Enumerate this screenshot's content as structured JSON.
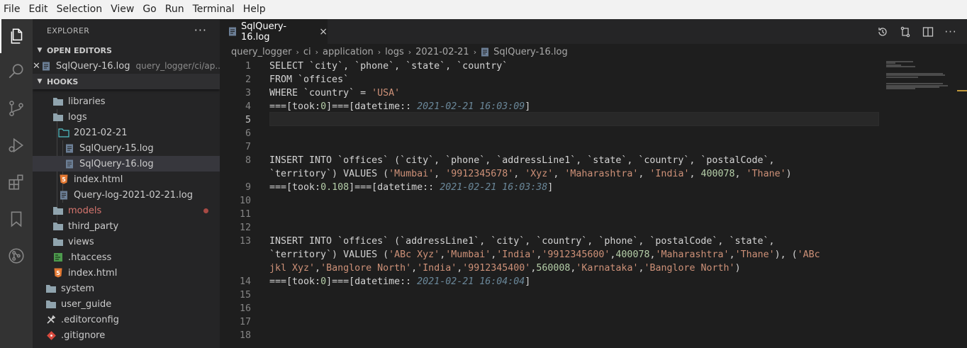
{
  "menu": [
    "File",
    "Edit",
    "Selection",
    "View",
    "Go",
    "Run",
    "Terminal",
    "Help"
  ],
  "sidebar": {
    "title": "EXPLORER",
    "open_editors_label": "OPEN EDITORS",
    "open_editor": {
      "name": "SqlQuery-16.log",
      "desc": "query_logger/ci/ap..."
    },
    "hooks_label": "HOOKS",
    "tree": [
      {
        "label": "libraries",
        "type": "folder"
      },
      {
        "label": "logs",
        "type": "folder"
      },
      {
        "label": "2021-02-21",
        "type": "folder-open"
      },
      {
        "label": "SqlQuery-15.log",
        "type": "log"
      },
      {
        "label": "SqlQuery-16.log",
        "type": "log"
      },
      {
        "label": "index.html",
        "type": "html"
      },
      {
        "label": "Query-log-2021-02-21.log",
        "type": "log"
      },
      {
        "label": "models",
        "type": "folder"
      },
      {
        "label": "third_party",
        "type": "folder"
      },
      {
        "label": "views",
        "type": "folder"
      },
      {
        "label": ".htaccess",
        "type": "htaccess"
      },
      {
        "label": "index.html",
        "type": "html"
      },
      {
        "label": "system",
        "type": "folder"
      },
      {
        "label": "user_guide",
        "type": "folder"
      },
      {
        "label": ".editorconfig",
        "type": "config"
      },
      {
        "label": ".gitignore",
        "type": "git"
      }
    ]
  },
  "tab": {
    "label": "SqlQuery-16.log",
    "close": "×"
  },
  "breadcrumb": [
    "query_logger",
    "ci",
    "application",
    "logs",
    "2021-02-21",
    "SqlQuery-16.log"
  ],
  "editor": {
    "line_numbers": [
      "1",
      "2",
      "3",
      "4",
      "5",
      "6",
      "7",
      "8",
      "9",
      "10",
      "11",
      "12",
      "13",
      "14",
      "15",
      "16",
      "17",
      "18"
    ],
    "lines": [
      {
        "ln": "1",
        "parts": [
          [
            "t",
            "SELECT `city`, `phone`, `state`, `country`"
          ]
        ]
      },
      {
        "ln": "2",
        "parts": [
          [
            "t",
            "FROM `offices`"
          ]
        ]
      },
      {
        "ln": "3",
        "parts": [
          [
            "t",
            "WHERE `country` = "
          ],
          [
            "s",
            "'USA'"
          ]
        ]
      },
      {
        "ln": "4",
        "parts": [
          [
            "t",
            "===[took:"
          ],
          [
            "n",
            "0"
          ],
          [
            "t",
            "]===[datetime:: "
          ],
          [
            "d",
            "2021-02-21 16:03:09"
          ],
          [
            "t",
            "]"
          ]
        ]
      },
      {
        "ln": "5",
        "parts": []
      },
      {
        "ln": "6",
        "parts": []
      },
      {
        "ln": "7",
        "parts": []
      },
      {
        "ln": "8",
        "parts": [
          [
            "t",
            "INSERT INTO `offices` (`city`, `phone`, `addressLine1`, `state`, `country`, `postalCode`,"
          ]
        ]
      },
      {
        "ln": "",
        "parts": [
          [
            "t",
            "`territory`) VALUES ("
          ],
          [
            "s",
            "'Mumbai'"
          ],
          [
            "t",
            ", "
          ],
          [
            "s",
            "'9912345678'"
          ],
          [
            "t",
            ", "
          ],
          [
            "s",
            "'Xyz'"
          ],
          [
            "t",
            ", "
          ],
          [
            "s",
            "'Maharashtra'"
          ],
          [
            "t",
            ", "
          ],
          [
            "s",
            "'India'"
          ],
          [
            "t",
            ", "
          ],
          [
            "n",
            "400078"
          ],
          [
            "t",
            ", "
          ],
          [
            "s",
            "'Thane'"
          ],
          [
            "t",
            ")"
          ]
        ]
      },
      {
        "ln": "9",
        "parts": [
          [
            "t",
            "===[took:"
          ],
          [
            "n",
            "0.108"
          ],
          [
            "t",
            "]===[datetime:: "
          ],
          [
            "d",
            "2021-02-21 16:03:38"
          ],
          [
            "t",
            "]"
          ]
        ]
      },
      {
        "ln": "10",
        "parts": []
      },
      {
        "ln": "11",
        "parts": []
      },
      {
        "ln": "12",
        "parts": []
      },
      {
        "ln": "13",
        "parts": [
          [
            "t",
            "INSERT INTO `offices` (`addressLine1`, `city`, `country`, `phone`, `postalCode`, `state`,"
          ]
        ]
      },
      {
        "ln": "",
        "parts": [
          [
            "t",
            "`territory`) VALUES ("
          ],
          [
            "s",
            "'ABc Xyz'"
          ],
          [
            "t",
            ","
          ],
          [
            "s",
            "'Mumbai'"
          ],
          [
            "t",
            ","
          ],
          [
            "s",
            "'India'"
          ],
          [
            "t",
            ","
          ],
          [
            "s",
            "'9912345600'"
          ],
          [
            "t",
            ","
          ],
          [
            "n",
            "400078"
          ],
          [
            "t",
            ","
          ],
          [
            "s",
            "'Maharashtra'"
          ],
          [
            "t",
            ","
          ],
          [
            "s",
            "'Thane'"
          ],
          [
            "t",
            "), ("
          ],
          [
            "s",
            "'ABc"
          ]
        ]
      },
      {
        "ln": "",
        "parts": [
          [
            "s",
            "jkl Xyz'"
          ],
          [
            "t",
            ","
          ],
          [
            "s",
            "'Banglore North'"
          ],
          [
            "t",
            ","
          ],
          [
            "s",
            "'India'"
          ],
          [
            "t",
            ","
          ],
          [
            "s",
            "'9912345400'"
          ],
          [
            "t",
            ","
          ],
          [
            "n",
            "560008"
          ],
          [
            "t",
            ","
          ],
          [
            "s",
            "'Karnataka'"
          ],
          [
            "t",
            ","
          ],
          [
            "s",
            "'Banglore North'"
          ],
          [
            "t",
            ")"
          ]
        ]
      },
      {
        "ln": "14",
        "parts": [
          [
            "t",
            "===[took:"
          ],
          [
            "n",
            "0"
          ],
          [
            "t",
            "]===[datetime:: "
          ],
          [
            "d",
            "2021-02-21 16:04:04"
          ],
          [
            "t",
            "]"
          ]
        ]
      },
      {
        "ln": "15",
        "parts": []
      },
      {
        "ln": "16",
        "parts": []
      },
      {
        "ln": "17",
        "parts": []
      },
      {
        "ln": "18",
        "parts": []
      }
    ]
  },
  "icons": {
    "activity": [
      "files-icon",
      "search-icon",
      "source-control-icon",
      "run-debug-icon",
      "extensions-icon",
      "bookmarks-icon",
      "git-graph-icon"
    ],
    "tab_actions": [
      "timeline-icon",
      "compare-changes-icon",
      "split-editor-icon",
      "more-actions-icon"
    ]
  },
  "colors": {
    "string": "#ce9178",
    "number": "#b5cea8",
    "datetime": "#6a8799",
    "modified_dot": "#a74a44"
  }
}
